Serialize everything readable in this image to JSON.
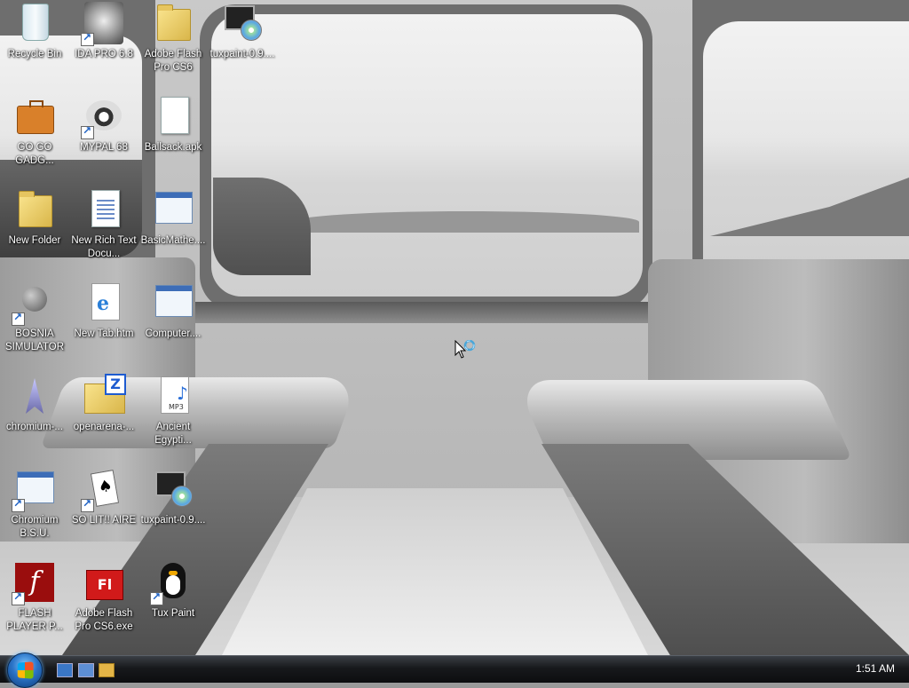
{
  "desktop": {
    "icons": [
      {
        "label": "Recycle Bin"
      },
      {
        "label": "IDA PRO 6.8"
      },
      {
        "label": "Adobe Flash Pro CS6"
      },
      {
        "label": "tuxpaint-0.9...."
      },
      {
        "label": "GO GO GADG..."
      },
      {
        "label": "MYPAL 68"
      },
      {
        "label": "Ballsack.apk"
      },
      {
        "label": "New Folder"
      },
      {
        "label": "New Rich Text Docu..."
      },
      {
        "label": "BasicMathe...."
      },
      {
        "label": "BOSNIA SIMULATOR"
      },
      {
        "label": "New Tab.htm"
      },
      {
        "label": "Computer...."
      },
      {
        "label": "chromium-..."
      },
      {
        "label": "openarena-..."
      },
      {
        "label": "Ancient Egypti..."
      },
      {
        "label": "Chromium B.S.U."
      },
      {
        "label": "SO LIT!! AIRE"
      },
      {
        "label": "tuxpaint-0.9...."
      },
      {
        "label": "FLASH PLAYER P..."
      },
      {
        "label": "Adobe Flash Pro CS6.exe"
      },
      {
        "label": "Tux Paint"
      }
    ]
  },
  "taskbar": {
    "clock": "1:51 AM"
  },
  "colors": {
    "taskbar": "#17191c",
    "start_orb": "#2b74c8",
    "icon_label": "#ffffff"
  }
}
